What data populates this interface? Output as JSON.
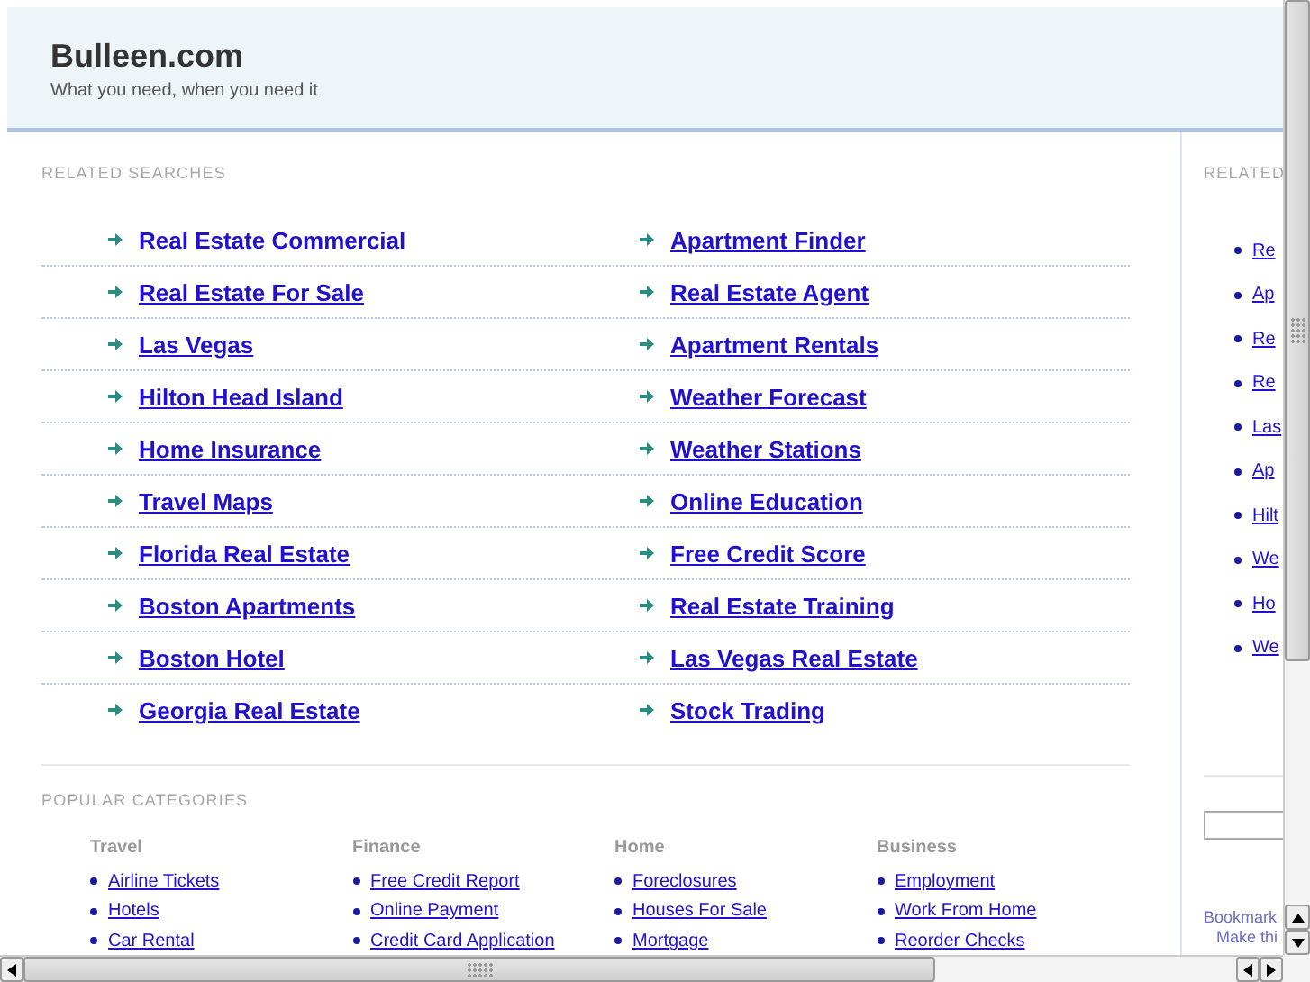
{
  "site": {
    "title": "Bulleen.com",
    "tagline": "What you need, when you need it"
  },
  "related_searches": {
    "heading": "RELATED SEARCHES",
    "rows": [
      {
        "links": [
          {
            "label": "Real Estate Commercial",
            "hovered": true
          },
          {
            "label": "Apartment Finder",
            "hovered": false
          }
        ]
      },
      {
        "links": [
          {
            "label": "Real Estate For Sale",
            "hovered": false
          },
          {
            "label": "Real Estate Agent",
            "hovered": false
          }
        ]
      },
      {
        "links": [
          {
            "label": "Las Vegas",
            "hovered": false
          },
          {
            "label": "Apartment Rentals",
            "hovered": false
          }
        ]
      },
      {
        "links": [
          {
            "label": "Hilton Head Island",
            "hovered": false
          },
          {
            "label": "Weather Forecast",
            "hovered": false
          }
        ]
      },
      {
        "links": [
          {
            "label": "Home Insurance",
            "hovered": false
          },
          {
            "label": "Weather Stations",
            "hovered": false
          }
        ]
      },
      {
        "links": [
          {
            "label": "Travel Maps",
            "hovered": false
          },
          {
            "label": "Online Education",
            "hovered": false
          }
        ]
      },
      {
        "links": [
          {
            "label": "Florida Real Estate",
            "hovered": false
          },
          {
            "label": "Free Credit Score",
            "hovered": false
          }
        ]
      },
      {
        "links": [
          {
            "label": "Boston Apartments",
            "hovered": false
          },
          {
            "label": "Real Estate Training",
            "hovered": false
          }
        ]
      },
      {
        "links": [
          {
            "label": "Boston Hotel",
            "hovered": false
          },
          {
            "label": "Las Vegas Real Estate",
            "hovered": false
          }
        ]
      },
      {
        "links": [
          {
            "label": "Georgia Real Estate",
            "hovered": false
          },
          {
            "label": "Stock Trading",
            "hovered": false
          }
        ]
      }
    ]
  },
  "popular_categories": {
    "heading": "POPULAR CATEGORIES",
    "categories": [
      {
        "name": "Travel",
        "links": [
          "Airline Tickets",
          "Hotels",
          "Car Rental"
        ]
      },
      {
        "name": "Finance",
        "links": [
          "Free Credit Report",
          "Online Payment",
          "Credit Card Application"
        ]
      },
      {
        "name": "Home",
        "links": [
          "Foreclosures",
          "Houses For Sale",
          "Mortgage"
        ]
      },
      {
        "name": "Business",
        "links": [
          "Employment",
          "Work From Home",
          "Reorder Checks"
        ]
      }
    ]
  },
  "sidebar": {
    "heading": "RELATED",
    "links": [
      "Re",
      "Ap",
      "Re",
      "Re",
      "Las",
      "Ap",
      "Hilt",
      "We",
      "Ho",
      "We"
    ],
    "footer_links": [
      "Bookmark",
      "Make thi"
    ]
  }
}
